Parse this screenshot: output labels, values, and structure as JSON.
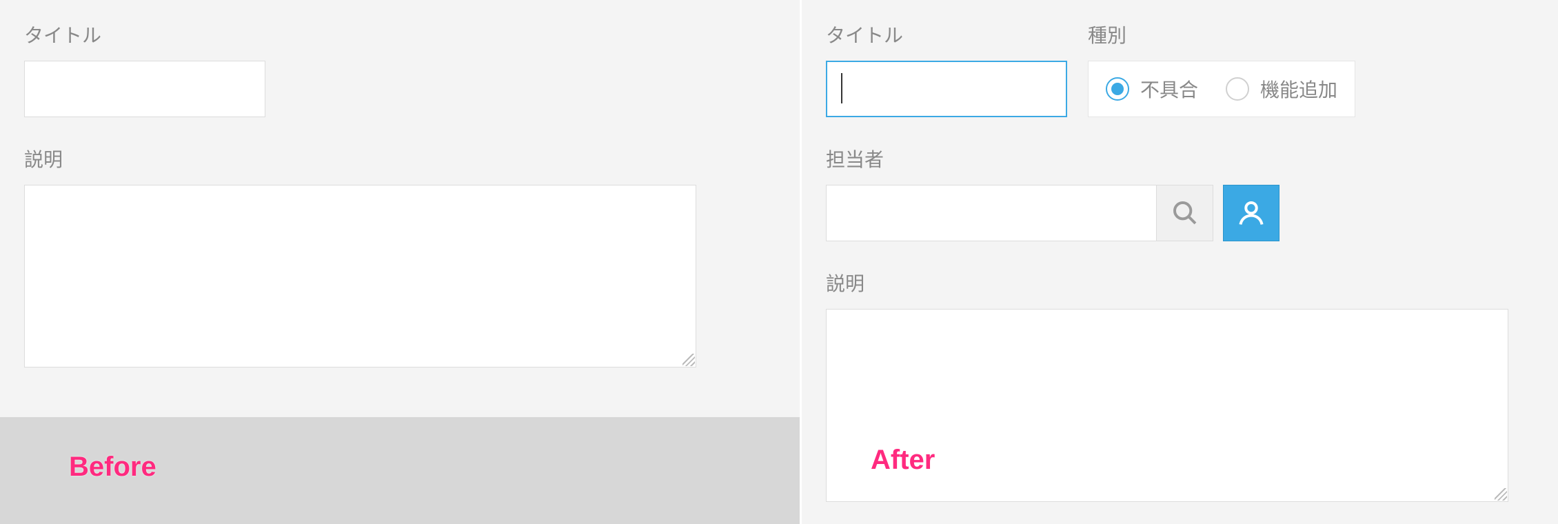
{
  "before": {
    "title_label": "タイトル",
    "title_value": "",
    "description_label": "説明",
    "description_value": "",
    "badge": "Before"
  },
  "after": {
    "title_label": "タイトル",
    "title_value": "",
    "type_label": "種別",
    "type_options": [
      {
        "label": "不具合",
        "checked": true
      },
      {
        "label": "機能追加",
        "checked": false
      }
    ],
    "assignee_label": "担当者",
    "assignee_value": "",
    "description_label": "説明",
    "description_value": "",
    "badge": "After"
  },
  "colors": {
    "accent": "#3ba9e4",
    "badge": "#ff2a7f",
    "bg": "#f4f4f4"
  }
}
